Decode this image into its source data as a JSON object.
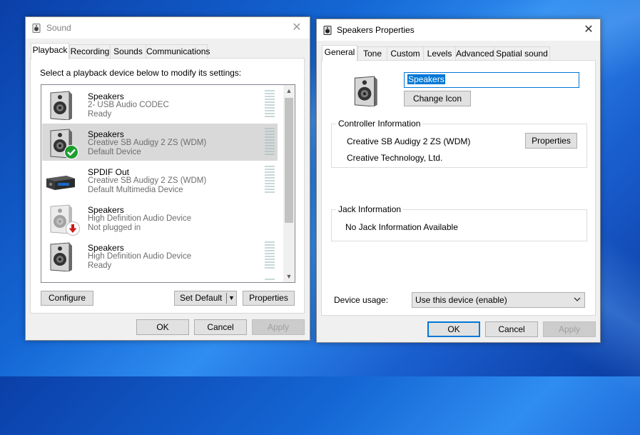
{
  "sound_window": {
    "title": "Sound",
    "tabs": [
      "Playback",
      "Recording",
      "Sounds",
      "Communications"
    ],
    "instruction": "Select a playback device below to modify its settings:",
    "devices": [
      {
        "name": "Speakers",
        "line1": "2- USB Audio CODEC",
        "line2": "Ready",
        "icon": "speaker-icon",
        "badge": ""
      },
      {
        "name": "Speakers",
        "line1": "Creative SB Audigy 2 ZS (WDM)",
        "line2": "Default Device",
        "icon": "speaker-icon",
        "badge": "default-check-icon"
      },
      {
        "name": "SPDIF Out",
        "line1": "Creative SB Audigy 2 ZS (WDM)",
        "line2": "Default Multimedia Device",
        "icon": "spdif-receiver-icon",
        "badge": ""
      },
      {
        "name": "Speakers",
        "line1": "High Definition Audio Device",
        "line2": "Not plugged in",
        "icon": "speaker-icon",
        "badge": "unplugged-arrow-icon"
      },
      {
        "name": "Speakers",
        "line1": "High Definition Audio Device",
        "line2": "Ready",
        "icon": "speaker-icon",
        "badge": ""
      }
    ],
    "buttons": {
      "configure": "Configure",
      "set_default": "Set Default",
      "properties": "Properties",
      "ok": "OK",
      "cancel": "Cancel",
      "apply": "Apply"
    }
  },
  "props_window": {
    "title": "Speakers Properties",
    "tabs": [
      "General",
      "Tone",
      "Custom",
      "Levels",
      "Advanced",
      "Spatial sound"
    ],
    "name_value": "Speakers",
    "change_icon": "Change Icon",
    "controller_group": "Controller Information",
    "controller_name": "Creative SB Audigy 2 ZS (WDM)",
    "controller_vendor": "Creative Technology, Ltd.",
    "properties_button": "Properties",
    "jack_group": "Jack Information",
    "jack_text": "No Jack Information Available",
    "device_usage_label": "Device usage:",
    "device_usage_value": "Use this device (enable)",
    "buttons": {
      "ok": "OK",
      "cancel": "Cancel",
      "apply": "Apply"
    }
  },
  "colors": {
    "accent": "#0078d7",
    "selected_row": "#d9d9d9",
    "check_green": "#1e9e2f",
    "unplug_red": "#d01818"
  }
}
